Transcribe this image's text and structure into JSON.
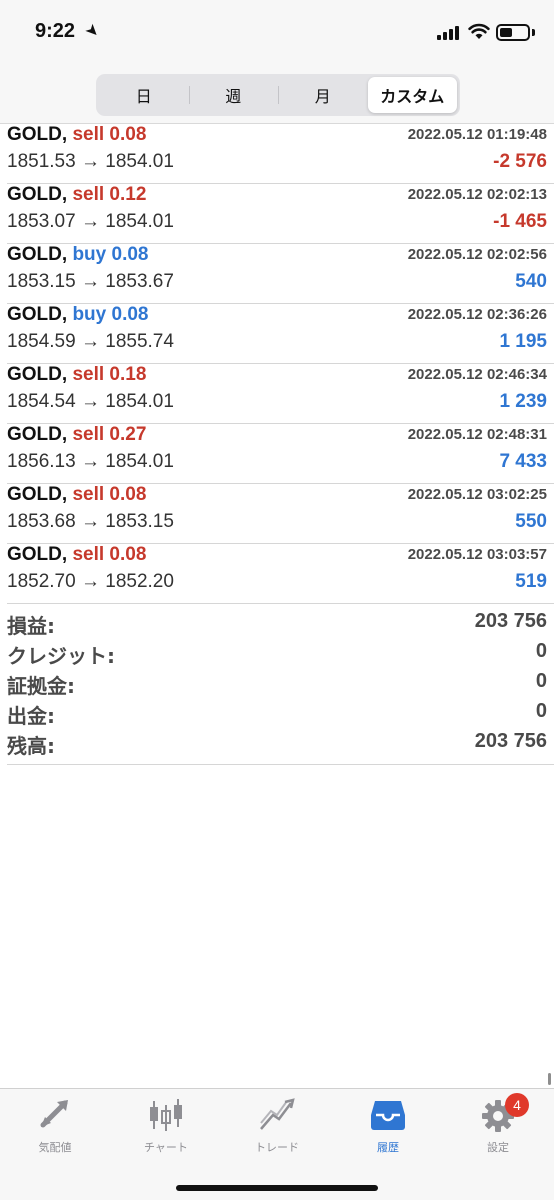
{
  "status_bar": {
    "time": "9:22"
  },
  "tabs": [
    "日",
    "週",
    "月",
    "カスタム"
  ],
  "active_tab_index": 3,
  "trades": [
    {
      "symbol": "GOLD,",
      "side": "sell",
      "volume": "sell 0.08",
      "open": "1851.53",
      "close": "1854.01",
      "time": "2022.05.12 01:19:48",
      "profit": "-2 576"
    },
    {
      "symbol": "GOLD,",
      "side": "sell",
      "volume": "sell 0.12",
      "open": "1853.07",
      "close": "1854.01",
      "time": "2022.05.12 02:02:13",
      "profit": "-1 465"
    },
    {
      "symbol": "GOLD,",
      "side": "buy",
      "volume": "buy 0.08",
      "open": "1853.15",
      "close": "1853.67",
      "time": "2022.05.12 02:02:56",
      "profit": "540"
    },
    {
      "symbol": "GOLD,",
      "side": "buy",
      "volume": "buy 0.08",
      "open": "1854.59",
      "close": "1855.74",
      "time": "2022.05.12 02:36:26",
      "profit": "1 195"
    },
    {
      "symbol": "GOLD,",
      "side": "sell",
      "volume": "sell 0.18",
      "open": "1854.54",
      "close": "1854.01",
      "time": "2022.05.12 02:46:34",
      "profit": "1 239"
    },
    {
      "symbol": "GOLD,",
      "side": "sell",
      "volume": "sell 0.27",
      "open": "1856.13",
      "close": "1854.01",
      "time": "2022.05.12 02:48:31",
      "profit": "7 433"
    },
    {
      "symbol": "GOLD,",
      "side": "sell",
      "volume": "sell 0.08",
      "open": "1853.68",
      "close": "1853.15",
      "time": "2022.05.12 03:02:25",
      "profit": "550"
    },
    {
      "symbol": "GOLD,",
      "side": "sell",
      "volume": "sell 0.08",
      "open": "1852.70",
      "close": "1852.20",
      "time": "2022.05.12 03:03:57",
      "profit": "519"
    }
  ],
  "price_arrow": "→",
  "summary": [
    {
      "label": "損益:",
      "value": "203 756"
    },
    {
      "label": "クレジット:",
      "value": "0"
    },
    {
      "label": "証拠金:",
      "value": "0"
    },
    {
      "label": "出金:",
      "value": "0"
    },
    {
      "label": "残高:",
      "value": "203 756"
    }
  ],
  "tabbar": [
    {
      "label": "気配値",
      "icon": "quotes-arrows-icon"
    },
    {
      "label": "チャート",
      "icon": "candlestick-chart-icon"
    },
    {
      "label": "トレード",
      "icon": "trade-trend-icon"
    },
    {
      "label": "履歴",
      "icon": "history-inbox-icon",
      "active": true
    },
    {
      "label": "設定",
      "icon": "settings-gear-icon",
      "badge": "4"
    }
  ],
  "colors": {
    "sell": "#c6392c",
    "buy": "#2f76d2",
    "active_tab": "#2f76d2",
    "inactive_tab": "#8e8e93",
    "badge": "#e0392b"
  }
}
